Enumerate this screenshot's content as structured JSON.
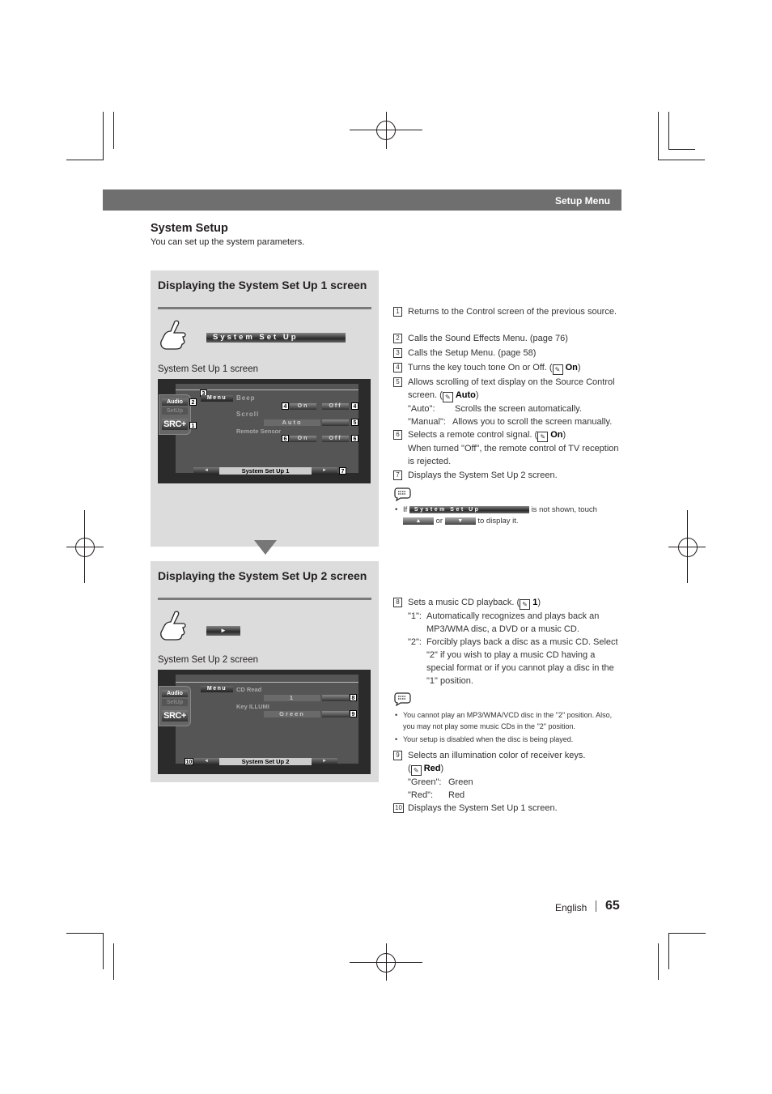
{
  "header": {
    "section": "Setup Menu"
  },
  "intro": {
    "title": "System Setup",
    "subtitle": "You can set up the system parameters."
  },
  "panel1": {
    "title": "Displaying the System Set Up 1 screen",
    "button_label": "System Set Up",
    "caption": "System Set Up 1 screen",
    "screen": {
      "side_buttons": [
        "Audio",
        "SetUp",
        "SRC+"
      ],
      "menu_button": "Menu",
      "rows": [
        {
          "label": "Beep",
          "options": [
            "On",
            "Off"
          ]
        },
        {
          "label": "Scroll",
          "value": "Auto"
        },
        {
          "label": "Remote Sensor",
          "options": [
            "On",
            "Off"
          ]
        }
      ],
      "nav_title": "System Set Up 1",
      "prev_arrow": "◄",
      "next_arrow": "►",
      "callouts": [
        "1",
        "2",
        "3",
        "4",
        "5",
        "6",
        "7"
      ]
    }
  },
  "panel2": {
    "title": "Displaying the System Set Up 2 screen",
    "button_label": "►",
    "caption": "System Set Up 2 screen",
    "screen": {
      "side_buttons": [
        "Audio",
        "SetUp",
        "SRC+"
      ],
      "menu_button": "Menu",
      "rows": [
        {
          "label": "CD Read",
          "value": "1"
        },
        {
          "label": "Key ILLUMI",
          "value": "Green"
        }
      ],
      "nav_title": "System Set Up 2",
      "prev_arrow": "◄",
      "next_arrow": "►",
      "callouts": [
        "8",
        "9",
        "10"
      ]
    }
  },
  "descriptions1": [
    {
      "n": "1",
      "text": "Returns to the Control screen of the previous source."
    },
    {
      "n": "2",
      "text": "Calls the Sound Effects Menu. (page 76)"
    },
    {
      "n": "3",
      "text": "Calls the Setup Menu. (page 58)"
    },
    {
      "n": "4",
      "text": "Turns the key touch tone On or Off. (",
      "default": "On",
      "close": ")"
    },
    {
      "n": "5",
      "text": "Allows scrolling of text display on the Source Control screen. (",
      "default": "Auto",
      "close": ")",
      "defs": [
        {
          "k": "\"Auto\":",
          "v": "Scrolls the screen automatically."
        },
        {
          "k": "\"Manual\":",
          "v": "Allows you to scroll the screen manually."
        }
      ]
    },
    {
      "n": "6",
      "text": "Selects a remote control signal. (",
      "default": "On",
      "close": ")",
      "extra": "When turned \"Off\", the remote control of TV reception is rejected."
    },
    {
      "n": "7",
      "text": "Displays the System Set Up 2 screen."
    }
  ],
  "note1": {
    "prefix": "If",
    "button": "System Set Up",
    "mid": "is not shown, touch",
    "up": "▲",
    "or": "or",
    "down": "▼",
    "suffix": "to display it."
  },
  "descriptions2": [
    {
      "n": "8",
      "text": "Sets a music CD playback. (",
      "default": "1",
      "close": ")",
      "defs": [
        {
          "k": "\"1\":",
          "v": "Automatically recognizes and plays back an MP3/WMA disc, a DVD or a music CD."
        },
        {
          "k": "\"2\":",
          "v": "Forcibly plays back a disc as a music CD. Select \"2\" if you wish to play a music CD having a special format or if you cannot play a disc in the \"1\" position."
        }
      ]
    }
  ],
  "note2": [
    "You cannot play an MP3/WMA/VCD disc in the \"2\" position. Also, you may not play some music CDs in the \"2\" position.",
    "Your setup is disabled when the disc is being played."
  ],
  "descriptions3": [
    {
      "n": "9",
      "text": "Selects an illumination color of receiver keys.",
      "open": "(",
      "default": "Red",
      "close": ")",
      "defs": [
        {
          "k": "\"Green\":",
          "v": "Green"
        },
        {
          "k": "\"Red\":",
          "v": "Red"
        }
      ]
    },
    {
      "n": "10",
      "text": "Displays the System Set Up 1 screen."
    }
  ],
  "footer": {
    "language": "English",
    "page": "65"
  }
}
